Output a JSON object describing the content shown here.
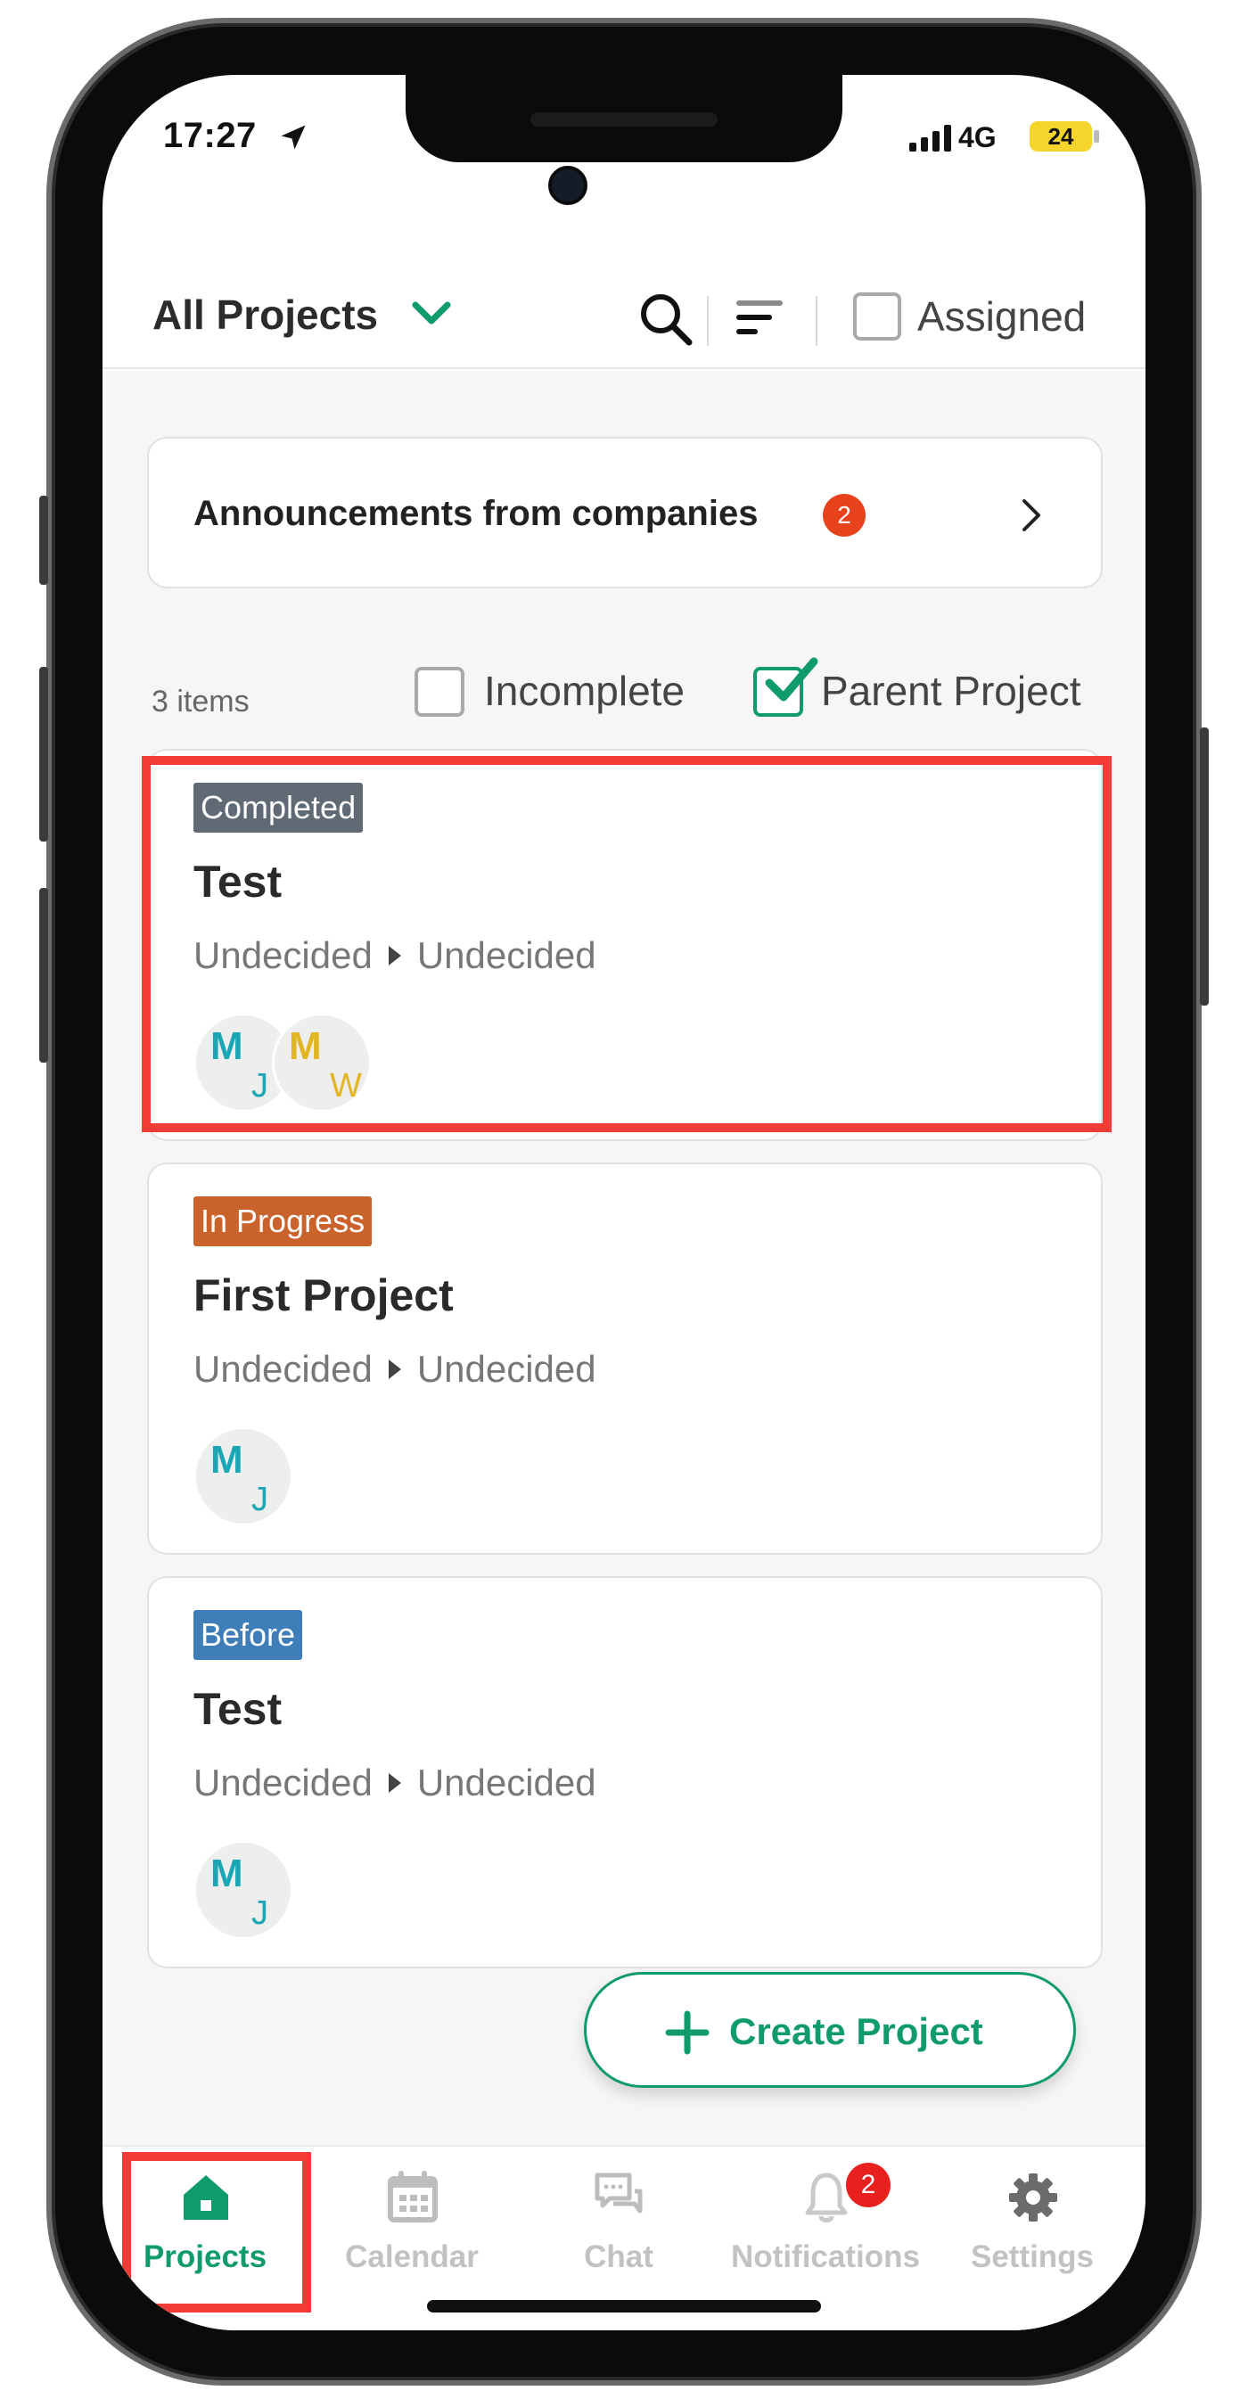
{
  "status_bar": {
    "time": "17:27",
    "network": "4G",
    "battery": "24"
  },
  "header": {
    "title": "All Projects",
    "assigned_label": "Assigned"
  },
  "announcement": {
    "text": "Announcements from companies",
    "badge": "2"
  },
  "filters": {
    "count": "3 items",
    "incomplete_label": "Incomplete",
    "parent_label": "Parent Project"
  },
  "projects": [
    {
      "status": "Completed",
      "status_color": "#5f6a75",
      "title": "Test",
      "from": "Undecided",
      "to": "Undecided",
      "members": [
        {
          "main": "M",
          "sub": "J",
          "color": "#1aa6b4"
        },
        {
          "main": "M",
          "sub": "W",
          "color": "#e2b523"
        }
      ]
    },
    {
      "status": "In Progress",
      "status_color": "#c9622b",
      "title": "First Project",
      "from": "Undecided",
      "to": "Undecided",
      "members": [
        {
          "main": "M",
          "sub": "J",
          "color": "#1aa6b4"
        }
      ]
    },
    {
      "status": "Before",
      "status_color": "#3f7db8",
      "title": "Test",
      "from": "Undecided",
      "to": "Undecided",
      "members": [
        {
          "main": "M",
          "sub": "J",
          "color": "#1aa6b4"
        }
      ]
    }
  ],
  "fab": {
    "label": "Create Project"
  },
  "tabs": [
    {
      "label": "Projects",
      "icon": "home-icon",
      "active": true
    },
    {
      "label": "Calendar",
      "icon": "calendar-icon",
      "active": false
    },
    {
      "label": "Chat",
      "icon": "chat-icon",
      "active": false
    },
    {
      "label": "Notifications",
      "icon": "bell-icon",
      "active": false,
      "badge": "2"
    },
    {
      "label": "Settings",
      "icon": "gear-icon",
      "active": false
    }
  ],
  "colors": {
    "accent": "#0f9b6e",
    "highlight": "#f03b36",
    "badge_red": "#e8421d"
  }
}
